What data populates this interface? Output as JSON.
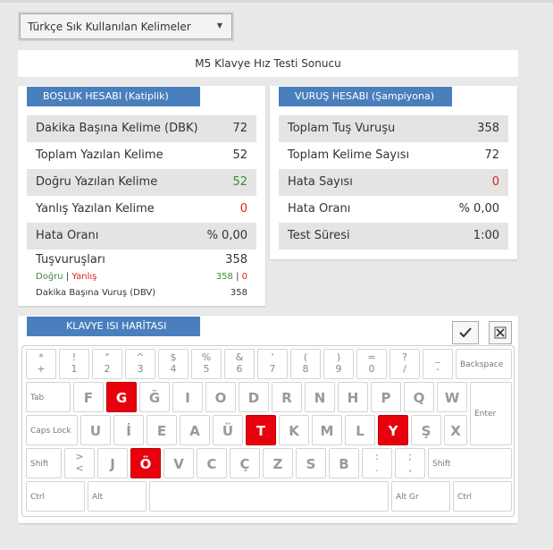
{
  "dropdown": {
    "selected": "Türkçe Sık Kullanılan Kelimeler",
    "arrow_icon": "caret-down-icon"
  },
  "banner": {
    "title": "M5 Klavye Hız Testi Sonucu"
  },
  "left_panel": {
    "title": "BOŞLUK HESABI (Katiplik)",
    "rows": [
      {
        "label": "Dakika Başına Kelime (DBK)",
        "value": "72"
      },
      {
        "label": "Toplam Yazılan Kelime",
        "value": "52"
      },
      {
        "label": "Doğru Yazılan Kelime",
        "value": "52"
      },
      {
        "label": "Yanlış Yazılan Kelime",
        "value": "0"
      },
      {
        "label": "Hata Oranı",
        "value": "% 0,00"
      }
    ],
    "keystrokes": {
      "label": "Tuşvuruşları",
      "value": "358"
    },
    "correct_label": "Doğru",
    "sep": "|",
    "wrong_label": "Yanlış",
    "correct_value": "358",
    "wrong_value": "0",
    "dbv": {
      "label": "Dakika Başına Vuruş (DBV)",
      "value": "358"
    }
  },
  "right_panel": {
    "title": "VURUŞ HESABI (Şampiyona)",
    "rows": [
      {
        "label": "Toplam Tuş Vuruşu",
        "value": "358"
      },
      {
        "label": "Toplam Kelime Sayısı",
        "value": "72"
      },
      {
        "label": "Hata Sayısı",
        "value": "0"
      },
      {
        "label": "Hata Oranı",
        "value": "% 0,00"
      },
      {
        "label": "Test Süresi",
        "value": "1:00"
      }
    ]
  },
  "keyboard": {
    "title": "KLAVYE ISI HARİTASI",
    "check_icon": "checkmark-icon",
    "close_icon": "close-icon",
    "row1": [
      {
        "up": "*",
        "down": "+"
      },
      {
        "up": "!",
        "down": "1"
      },
      {
        "up": "\"",
        "down": "2"
      },
      {
        "up": "^",
        "down": "3"
      },
      {
        "up": "$",
        "down": "4"
      },
      {
        "up": "%",
        "down": "5"
      },
      {
        "up": "&",
        "down": "6"
      },
      {
        "up": "'",
        "down": "7"
      },
      {
        "up": "(",
        "down": "8"
      },
      {
        "up": ")",
        "down": "9"
      },
      {
        "up": "=",
        "down": "0"
      },
      {
        "up": "?",
        "down": "/"
      },
      {
        "up": "_",
        "down": "-"
      }
    ],
    "backspace": "Backspace",
    "tab": "Tab",
    "row2": [
      "F",
      "G",
      "Ğ",
      "I",
      "O",
      "D",
      "R",
      "N",
      "H",
      "P",
      "Q",
      "W"
    ],
    "enter": "Enter",
    "capslock": "Caps Lock",
    "row3": [
      "U",
      "İ",
      "E",
      "A",
      "Ü",
      "T",
      "K",
      "M",
      "L",
      "Y",
      "Ş",
      "X"
    ],
    "shift_left": "Shift",
    "lt_up": ">",
    "lt_down": "<",
    "row4": [
      "J",
      "Ö",
      "V",
      "C",
      "Ç",
      "Z",
      "S",
      "B"
    ],
    "dot_up": ":",
    "dot_down": ".",
    "comma_up": ";",
    "comma_down": ",",
    "shift_right": "Shift",
    "ctrl_left": "Ctrl",
    "alt": "Alt",
    "altgr": "Alt Gr",
    "ctrl_right": "Ctrl",
    "hot_keys": [
      "G",
      "T",
      "Y",
      "Ö"
    ],
    "hot_color": "#e8000d"
  },
  "colors": {
    "title_bar": "#4a7fbd",
    "green": "#3c8d3c",
    "red": "#e02020"
  }
}
